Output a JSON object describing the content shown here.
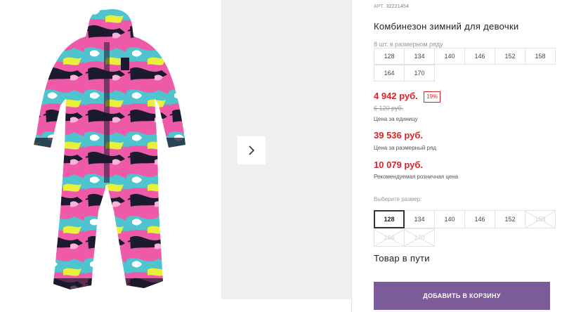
{
  "product": {
    "article_label": "АРТ.",
    "article_number": "32221454",
    "title": "Комбинезон зимний для девочки"
  },
  "row_sizes": {
    "label": "8 шт. в размерном ряду",
    "sizes": [
      "128",
      "134",
      "140",
      "146",
      "152",
      "158",
      "164",
      "170"
    ]
  },
  "pricing": {
    "unit_price": "4 942 руб.",
    "discount_badge": "19%",
    "old_price": "6 120 руб.",
    "unit_price_caption": "Цена за единицу",
    "row_price": "39 536 руб.",
    "row_price_caption": "Цена за размерный ряд",
    "retail_price": "10 079 руб.",
    "retail_price_caption": "Рекомендуемая розничная цена"
  },
  "size_picker": {
    "label": "Выберите размер:",
    "sizes": [
      {
        "value": "128",
        "state": "selected"
      },
      {
        "value": "134",
        "state": "available"
      },
      {
        "value": "140",
        "state": "available"
      },
      {
        "value": "146",
        "state": "available"
      },
      {
        "value": "152",
        "state": "available"
      },
      {
        "value": "158",
        "state": "unavailable"
      },
      {
        "value": "164",
        "state": "unavailable"
      },
      {
        "value": "170",
        "state": "unavailable"
      }
    ]
  },
  "availability": "Товар в пути",
  "cart_button": "ДОБАВИТЬ В КОРЗИНУ",
  "gallery": {
    "next_icon": "chevron-right-icon",
    "image": "winter-jumpsuit-graffiti-print"
  },
  "colors": {
    "accent_red": "#d8232a",
    "button_purple": "#7b5c98"
  }
}
